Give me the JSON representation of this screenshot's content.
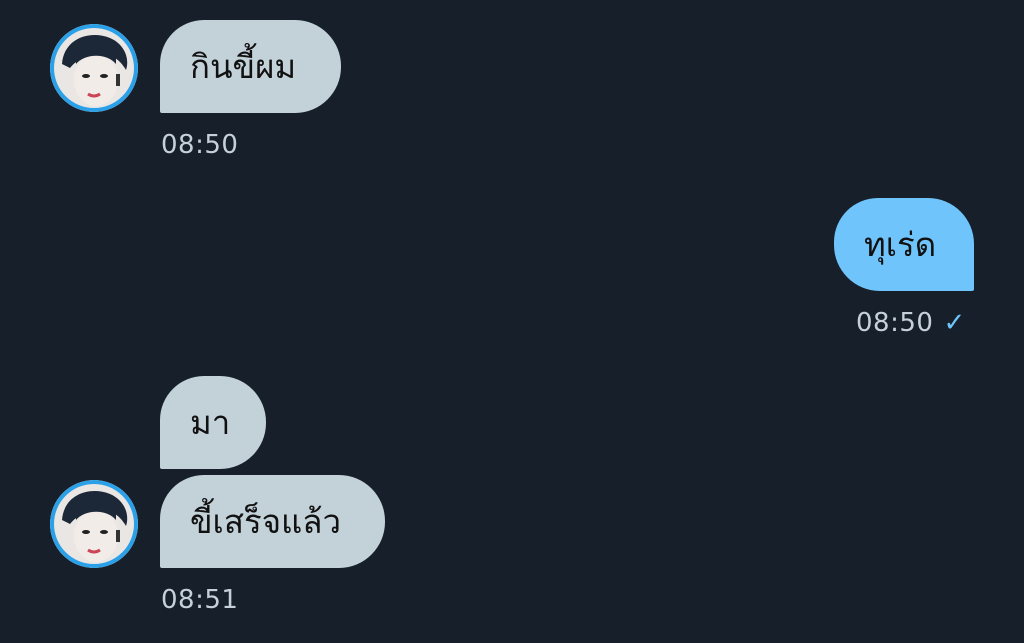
{
  "conversation": {
    "messages": [
      {
        "direction": "received",
        "text": "กินขี้ผม",
        "time": "08:50"
      },
      {
        "direction": "sent",
        "text": "ทุเร่ด",
        "time": "08:50",
        "status_icon": "check-icon"
      },
      {
        "direction": "received",
        "text": "มา"
      },
      {
        "direction": "received",
        "text": "ขี้เสร็จแล้ว",
        "time": "08:51"
      }
    ],
    "check_glyph": "✓",
    "colors": {
      "background": "#161f2a",
      "received_bubble": "#c3d1d9",
      "sent_bubble": "#6fc5fb",
      "timestamp": "#c6d0d8"
    }
  }
}
